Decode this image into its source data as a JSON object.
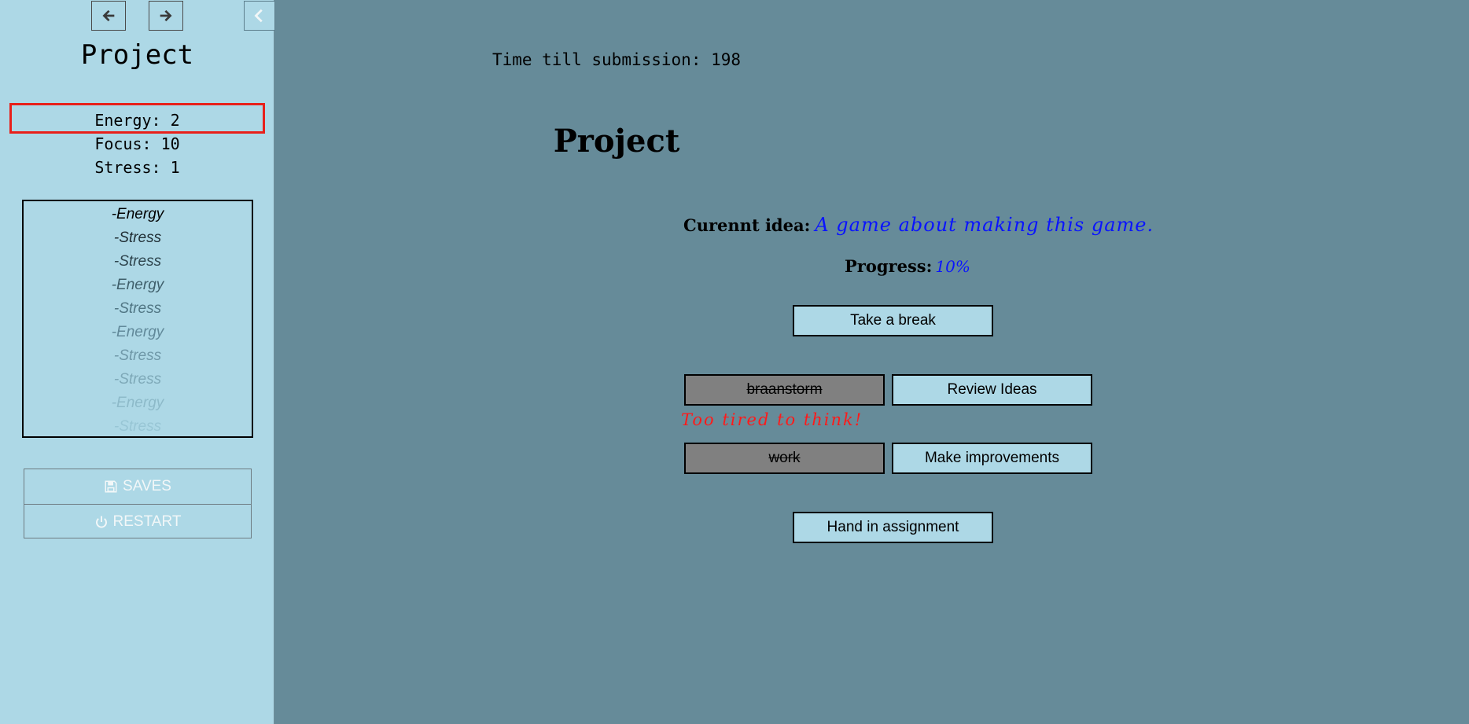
{
  "sidebar": {
    "title": "Project",
    "stats": {
      "energy": "Energy: 2",
      "focus": "Focus: 10",
      "stress": "Stress: 1"
    },
    "history": [
      {
        "label": "-Energy",
        "color": "#000000"
      },
      {
        "label": "-Stress",
        "color": "#1f2d33"
      },
      {
        "label": "-Stress",
        "color": "#2e454e"
      },
      {
        "label": "-Energy",
        "color": "#3f5f6b"
      },
      {
        "label": "-Stress",
        "color": "#507684"
      },
      {
        "label": "-Energy",
        "color": "#61899a"
      },
      {
        "label": "-Stress",
        "color": "#6f98a8"
      },
      {
        "label": "-Stress",
        "color": "#7ea9b8"
      },
      {
        "label": "-Energy",
        "color": "#8dbac9"
      },
      {
        "label": "-Stress",
        "color": "#98c6d5"
      }
    ],
    "menu": {
      "saves": "SAVES",
      "restart": "RESTART"
    }
  },
  "main": {
    "timer": "Time till submission: 198",
    "title": "Project",
    "idea_label": "Curennt idea:",
    "idea_value": "A game about making this game.",
    "progress_label": "Progress:",
    "progress_value": "10%",
    "buttons": {
      "take_break": "Take a break",
      "brainstorm": "braanstorm",
      "review_ideas": "Review Ideas",
      "work": "work",
      "make_improvements": "Make improvements",
      "hand_in": "Hand in assignment"
    },
    "warning": "Too tired to think!"
  },
  "colors": {
    "sidebar_bg": "#add8e6",
    "main_bg": "#668b99",
    "highlight": "#e8201a",
    "accent_text": "#0a14ff",
    "disabled_button": "#808080"
  }
}
